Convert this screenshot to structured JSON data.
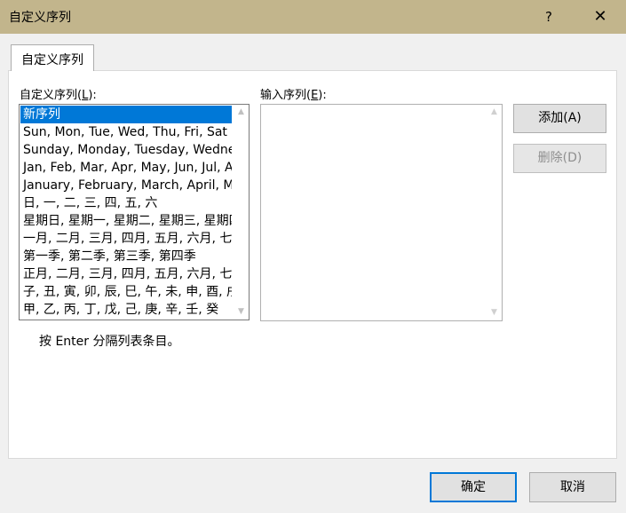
{
  "window": {
    "title": "自定义序列",
    "help": "?",
    "close": "✕"
  },
  "tab": {
    "label": "自定义序列"
  },
  "custom_lists": {
    "label_prefix": "自定义序列(",
    "label_key": "L",
    "label_suffix": "):",
    "items": [
      "新序列",
      "Sun, Mon, Tue, Wed, Thu, Fri, Sat",
      "Sunday, Monday, Tuesday, Wednesday, Thursday, Friday, Saturday",
      "Jan, Feb, Mar, Apr, May, Jun, Jul, Aug, Sep, Oct, Nov, Dec",
      "January, February, March, April, May, June, July, August, September, October, November, December",
      "日, 一, 二, 三, 四, 五, 六",
      "星期日, 星期一, 星期二, 星期三, 星期四, 星期五, 星期六",
      "一月, 二月, 三月, 四月, 五月, 六月, 七月, 八月, 九月, 十月, 十一月, 十二月",
      "第一季, 第二季, 第三季, 第四季",
      "正月, 二月, 三月, 四月, 五月, 六月, 七月, 八月, 九月, 十月, 十一月, 腊月",
      "子, 丑, 寅, 卯, 辰, 巳, 午, 未, 申, 酉, 戌, 亥",
      "甲, 乙, 丙, 丁, 戊, 己, 庚, 辛, 壬, 癸"
    ],
    "selected_index": 0
  },
  "list_entries": {
    "label_prefix": "输入序列(",
    "label_key": "E",
    "label_suffix": "):",
    "value": ""
  },
  "buttons": {
    "add": "添加(A)",
    "delete": "删除(D)",
    "ok": "确定",
    "cancel": "取消"
  },
  "hint": "按 Enter 分隔列表条目。",
  "colors": {
    "titlebar": "#c2b58c",
    "selection": "#0078d7"
  }
}
